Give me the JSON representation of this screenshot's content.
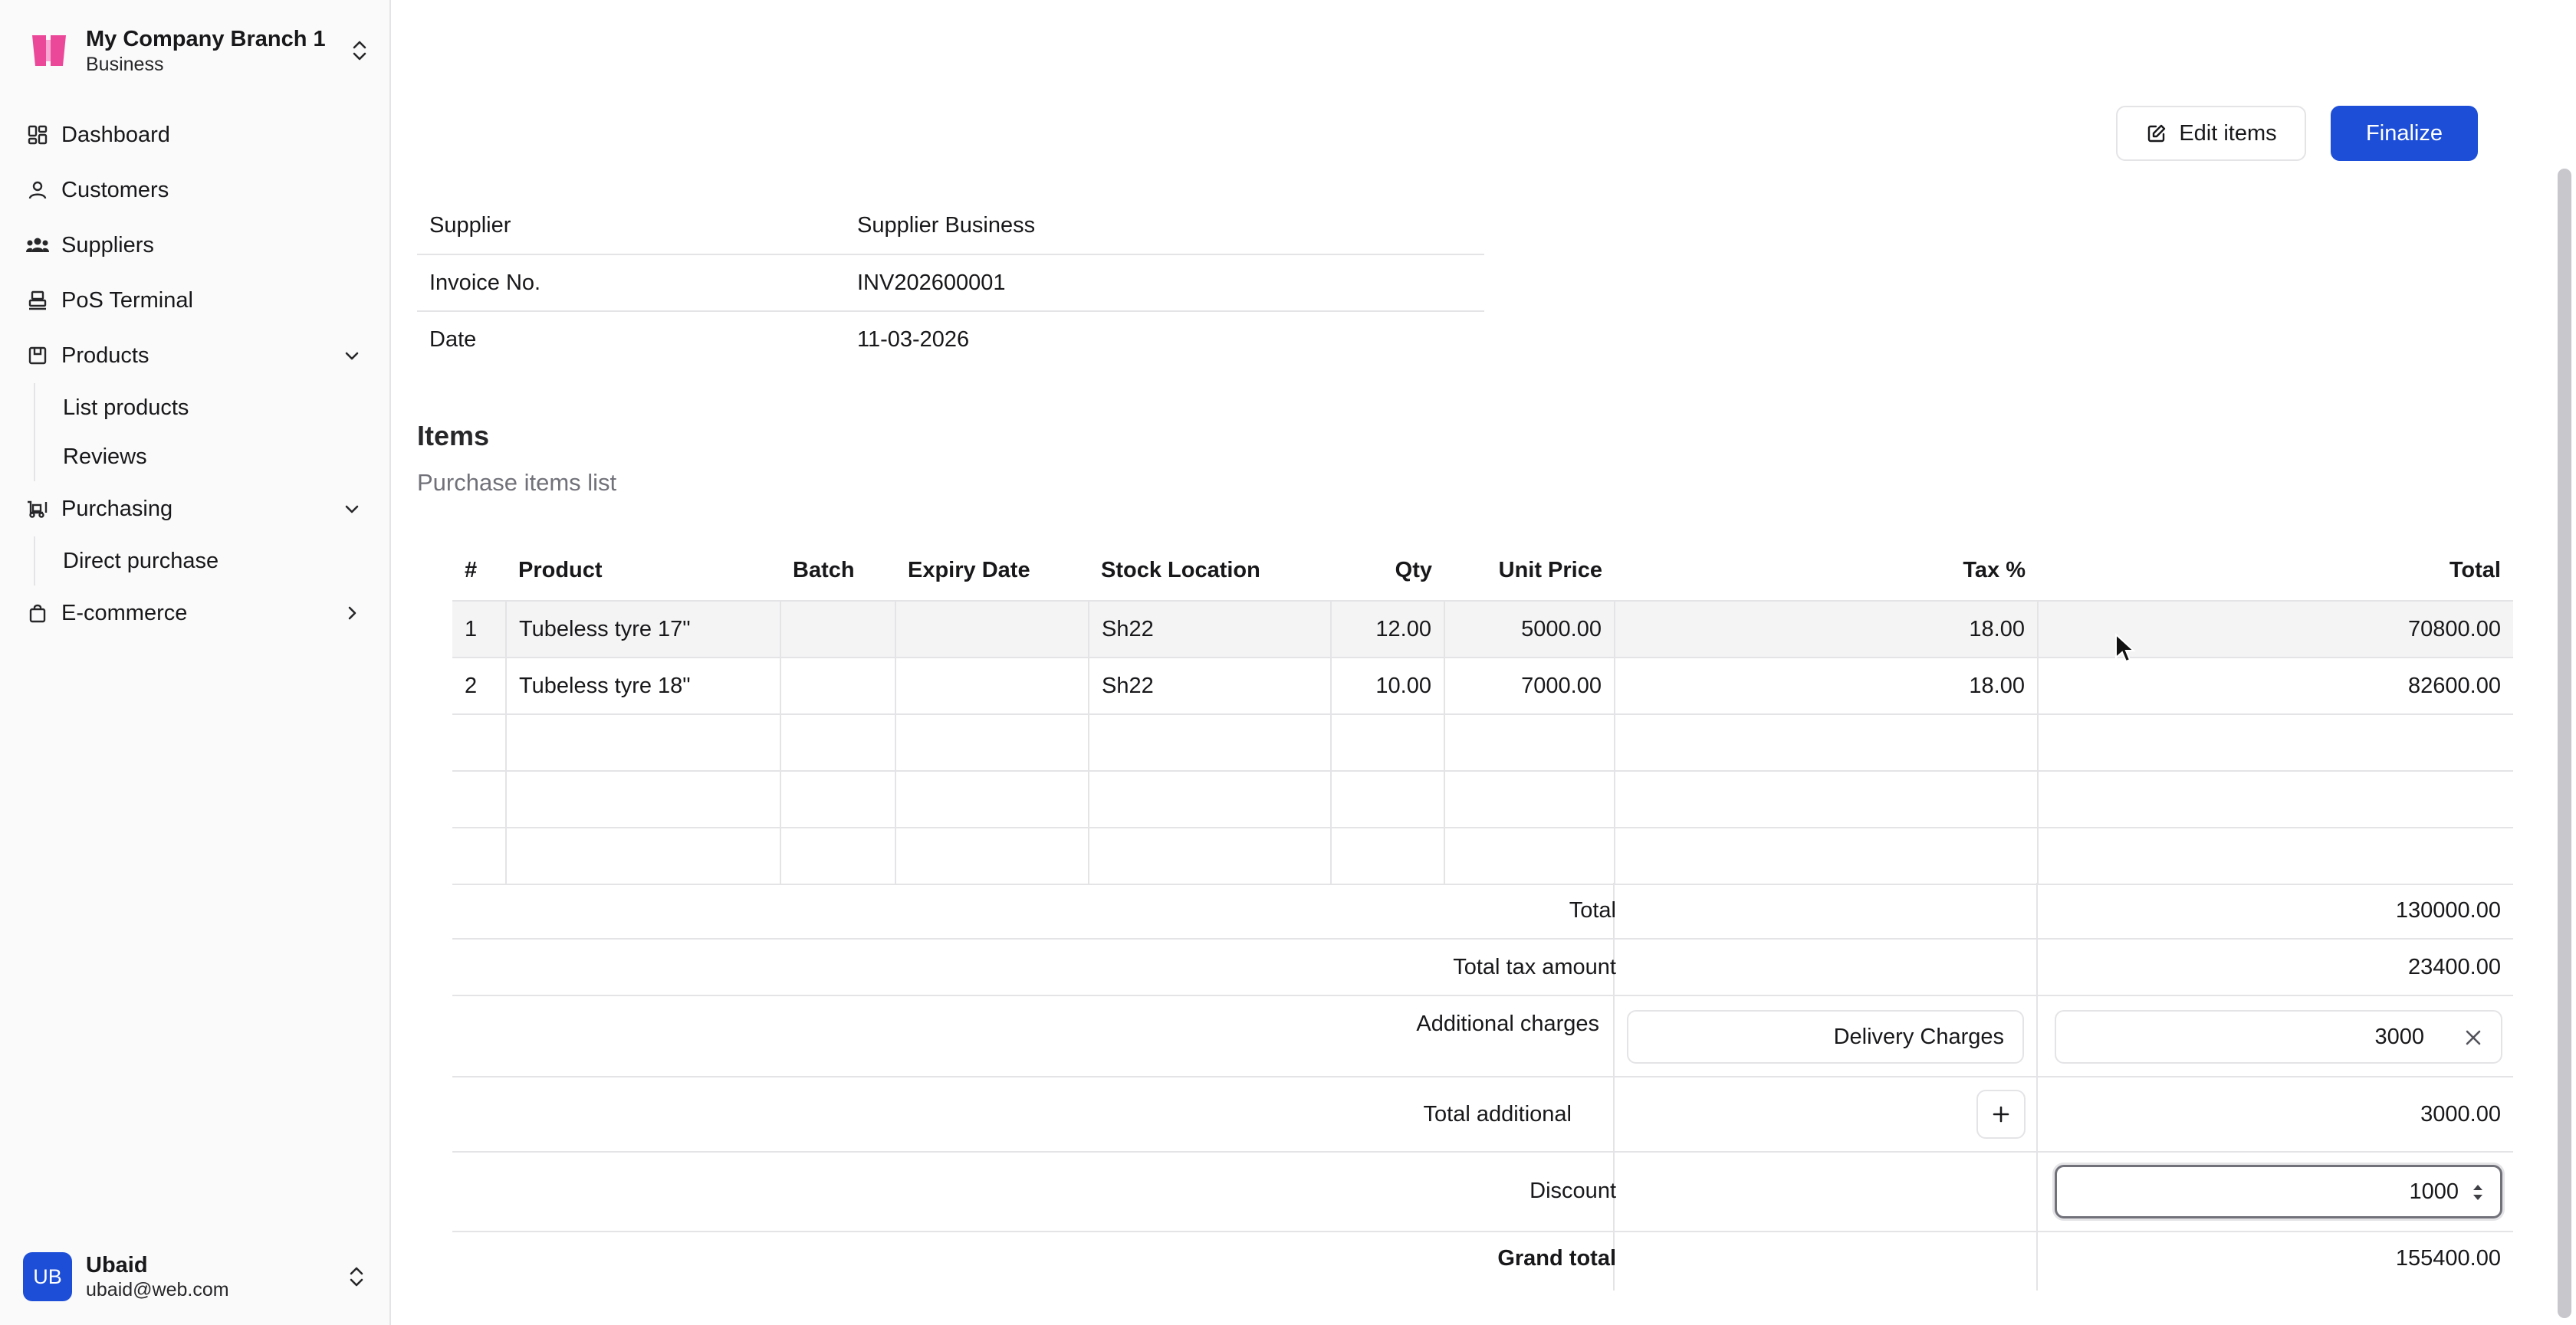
{
  "org": {
    "name": "My Company Branch 1",
    "type": "Business"
  },
  "nav": {
    "dashboard": "Dashboard",
    "customers": "Customers",
    "suppliers": "Suppliers",
    "pos": "PoS Terminal",
    "products": "Products",
    "products_children": [
      "List products",
      "Reviews"
    ],
    "purchasing": "Purchasing",
    "purchasing_children": [
      "Direct purchase"
    ],
    "ecommerce": "E-commerce"
  },
  "user": {
    "initials": "UB",
    "name": "Ubaid",
    "email": "ubaid@web.com"
  },
  "actions": {
    "edit": "Edit items",
    "finalize": "Finalize"
  },
  "info": [
    {
      "label": "Supplier",
      "value": "Supplier Business"
    },
    {
      "label": "Invoice No.",
      "value": "INV202600001"
    },
    {
      "label": "Date",
      "value": "11-03-2026"
    }
  ],
  "items": {
    "title": "Items",
    "subtitle": "Purchase items list",
    "columns": [
      "#",
      "Product",
      "Batch",
      "Expiry Date",
      "Stock Location",
      "Qty",
      "Unit Price",
      "Tax %",
      "Total"
    ],
    "rows": [
      [
        "1",
        "Tubeless tyre 17\"",
        "",
        "",
        "Sh22",
        "12.00",
        "5000.00",
        "18.00",
        "70800.00"
      ],
      [
        "2",
        "Tubeless tyre 18\"",
        "",
        "",
        "Sh22",
        "10.00",
        "7000.00",
        "18.00",
        "82600.00"
      ]
    ]
  },
  "summary": {
    "total_label": "Total",
    "total_value": "130000.00",
    "tax_label": "Total tax amount",
    "tax_value": "23400.00",
    "charges_label": "Additional charges",
    "charge_name": "Delivery Charges",
    "charge_amount": "3000",
    "total_additional_label": "Total additional",
    "total_additional_value": "3000.00",
    "discount_label": "Discount",
    "discount_value": "1000",
    "grand_label": "Grand total",
    "grand_value": "155400.00"
  },
  "colors": {
    "primary": "#1d4ed8",
    "brand_pink": "#ec4899"
  }
}
